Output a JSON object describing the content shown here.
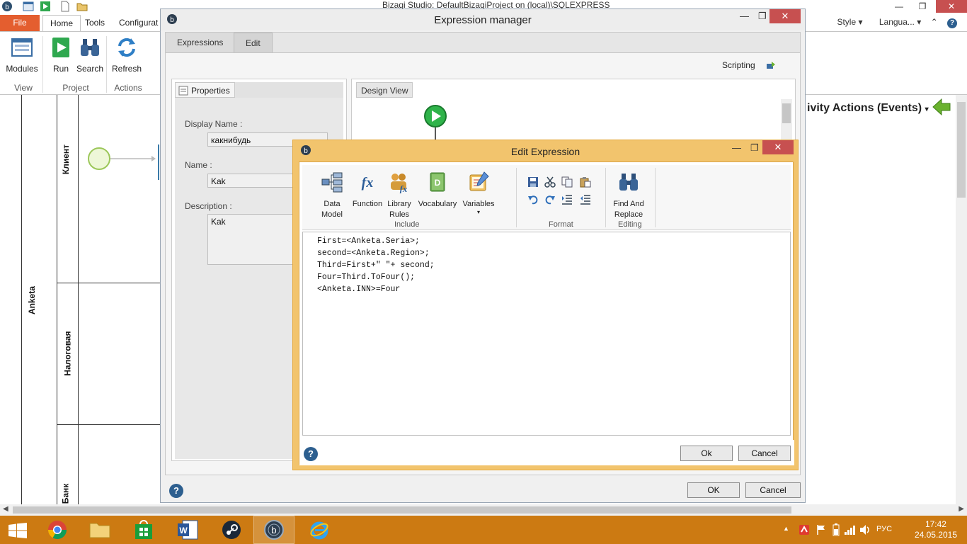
{
  "app": {
    "title": "Bizagi Studio: DefaultBizagiProject on (local)\\SQLEXPRESS",
    "tabs": [
      "File",
      "Home",
      "Tools",
      "Configurat"
    ],
    "right_menu": [
      "Style",
      "Langua..."
    ],
    "ribbon": {
      "buttons": {
        "modules": "Modules",
        "run": "Run",
        "search": "Search",
        "refresh": "Refresh"
      },
      "groups": {
        "view": "View",
        "project": "Project",
        "actions": "Actions"
      }
    },
    "process": {
      "pool": "Anketa",
      "lanes": [
        "Клиент",
        "Налоговая",
        "Банк"
      ]
    },
    "activity_actions": "ivity Actions (Events)"
  },
  "expression_manager": {
    "title": "Expression manager",
    "tabs": {
      "expressions": "Expressions",
      "edit": "Edit"
    },
    "scripting": "Scripting",
    "properties": {
      "tab": "Properties",
      "display_name_label": "Display Name :",
      "display_name_value": "какнибудь",
      "name_label": "Name :",
      "name_value": "Kak",
      "description_label": "Description :",
      "description_value": "Kak"
    },
    "design_view": "Design View",
    "ok": "OK",
    "cancel": "Cancel"
  },
  "edit_expression": {
    "title": "Edit Expression",
    "ribbon": {
      "data_model": "Data\nModel",
      "function": "Function",
      "library_rules": "Library\nRules",
      "vocabulary": "Vocabulary",
      "variables": "Variables",
      "find_replace": "Find And\nReplace",
      "groups": {
        "include": "Include",
        "format": "Format",
        "editing": "Editing"
      }
    },
    "code": [
      "First=<Anketa.Seria>;",
      "second=<Anketa.Region>;",
      "Third=First+\" \"+ second;",
      "Four=Third.ToFour();",
      "<Anketa.INN>=Four"
    ],
    "ok": "Ok",
    "cancel": "Cancel",
    "help": "?"
  },
  "taskbar": {
    "lang": "РУС",
    "time": "17:42",
    "date": "24.05.2015"
  },
  "colors": {
    "file_tab": "#e45e2f",
    "taskbar": "#cc7a12",
    "close": "#c75050",
    "dialog_border": "#f2c46d"
  }
}
